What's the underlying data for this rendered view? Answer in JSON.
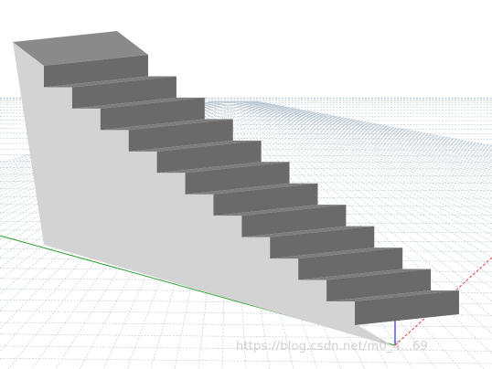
{
  "viewport": {
    "background": "#ffffff",
    "grid_color": "#b9c7d2",
    "colors": {
      "step_top": "#7d7d7d",
      "step_riser": "#6a6a6a",
      "side_face": "#d3d3d3",
      "back_top": "#8a8a8a",
      "axis_x": "#e23b3b",
      "axis_y": "#2fa02f",
      "axis_z": "#2d2dd8"
    },
    "model": {
      "name": "staircase",
      "step_count": 11
    },
    "watermark_text": "https://blog.csdn.net/m0_4...69"
  }
}
